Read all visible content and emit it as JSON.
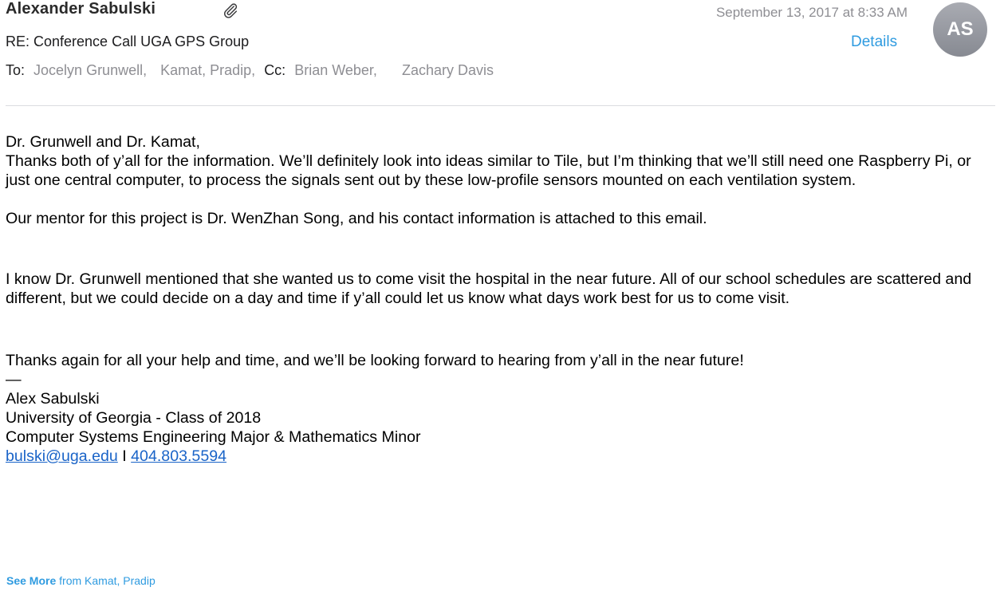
{
  "message": {
    "sender": "Alexander Sabulski",
    "date": "September 13, 2017 at 8:33 AM",
    "avatar_initials": "AS",
    "subject": "RE: Conference Call UGA GPS Group",
    "details_label": "Details",
    "to_label": "To:",
    "to": [
      "Jocelyn Grunwell,",
      "Kamat, Pradip,"
    ],
    "cc_label": "Cc:",
    "cc": [
      "Brian Weber,",
      "Zachary Davis"
    ]
  },
  "body": {
    "greeting": "Dr. Grunwell and Dr. Kamat,",
    "p1": "Thanks both of y’all for the information. We’ll definitely look into ideas similar to Tile, but I’m thinking that we’ll still need one Raspberry Pi, or just one central computer, to process the signals sent out by these low-profile sensors mounted on each ventilation system.",
    "p2": "Our mentor for this project is Dr. WenZhan Song, and his contact information is attached to this email.",
    "p3": "I know Dr. Grunwell mentioned that she wanted us to come visit the hospital in the near future. All of our school schedules are scattered and different, but we could decide on a day and time if y’all could let us know what days work best for us to come visit.",
    "p4": "Thanks again for all your help and time, and we’ll be looking forward to hearing from y’all in the near future!"
  },
  "signature": {
    "dash": "—",
    "name": "Alex Sabulski",
    "school": "University of Georgia - Class of 2018",
    "major": "Computer Systems Engineering Major & Mathematics Minor",
    "email": "bulski@uga.edu",
    "divider": " I ",
    "phone": "404.803.5594"
  },
  "footer": {
    "see_more": "See More",
    "from_text": " from Kamat, Pradip"
  },
  "colors": {
    "accent": "#2f9be0",
    "link": "#1a64c8",
    "muted": "#8e8e93"
  },
  "icons": {
    "attachment": "paperclip-icon"
  }
}
